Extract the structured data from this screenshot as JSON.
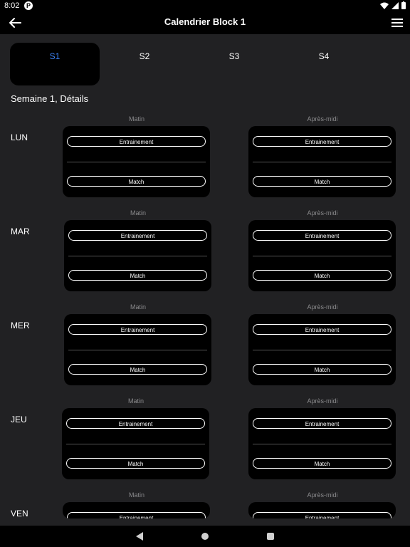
{
  "status_bar": {
    "time": "8:02",
    "app_icon_letter": "P"
  },
  "app_bar": {
    "title": "Calendrier Block 1"
  },
  "week_tabs": [
    "S1",
    "S2",
    "S3",
    "S4"
  ],
  "section_title": "Semaine 1, Détails",
  "period_labels": {
    "morning": "Matin",
    "afternoon": "Après-midi"
  },
  "days": [
    "LUN",
    "MAR",
    "MER",
    "JEU",
    "VEN"
  ],
  "slot_buttons": {
    "training": "Entrainement",
    "match": "Match"
  },
  "colors": {
    "accent": "#3b82f6",
    "background": "#212123",
    "card": "#000000"
  }
}
